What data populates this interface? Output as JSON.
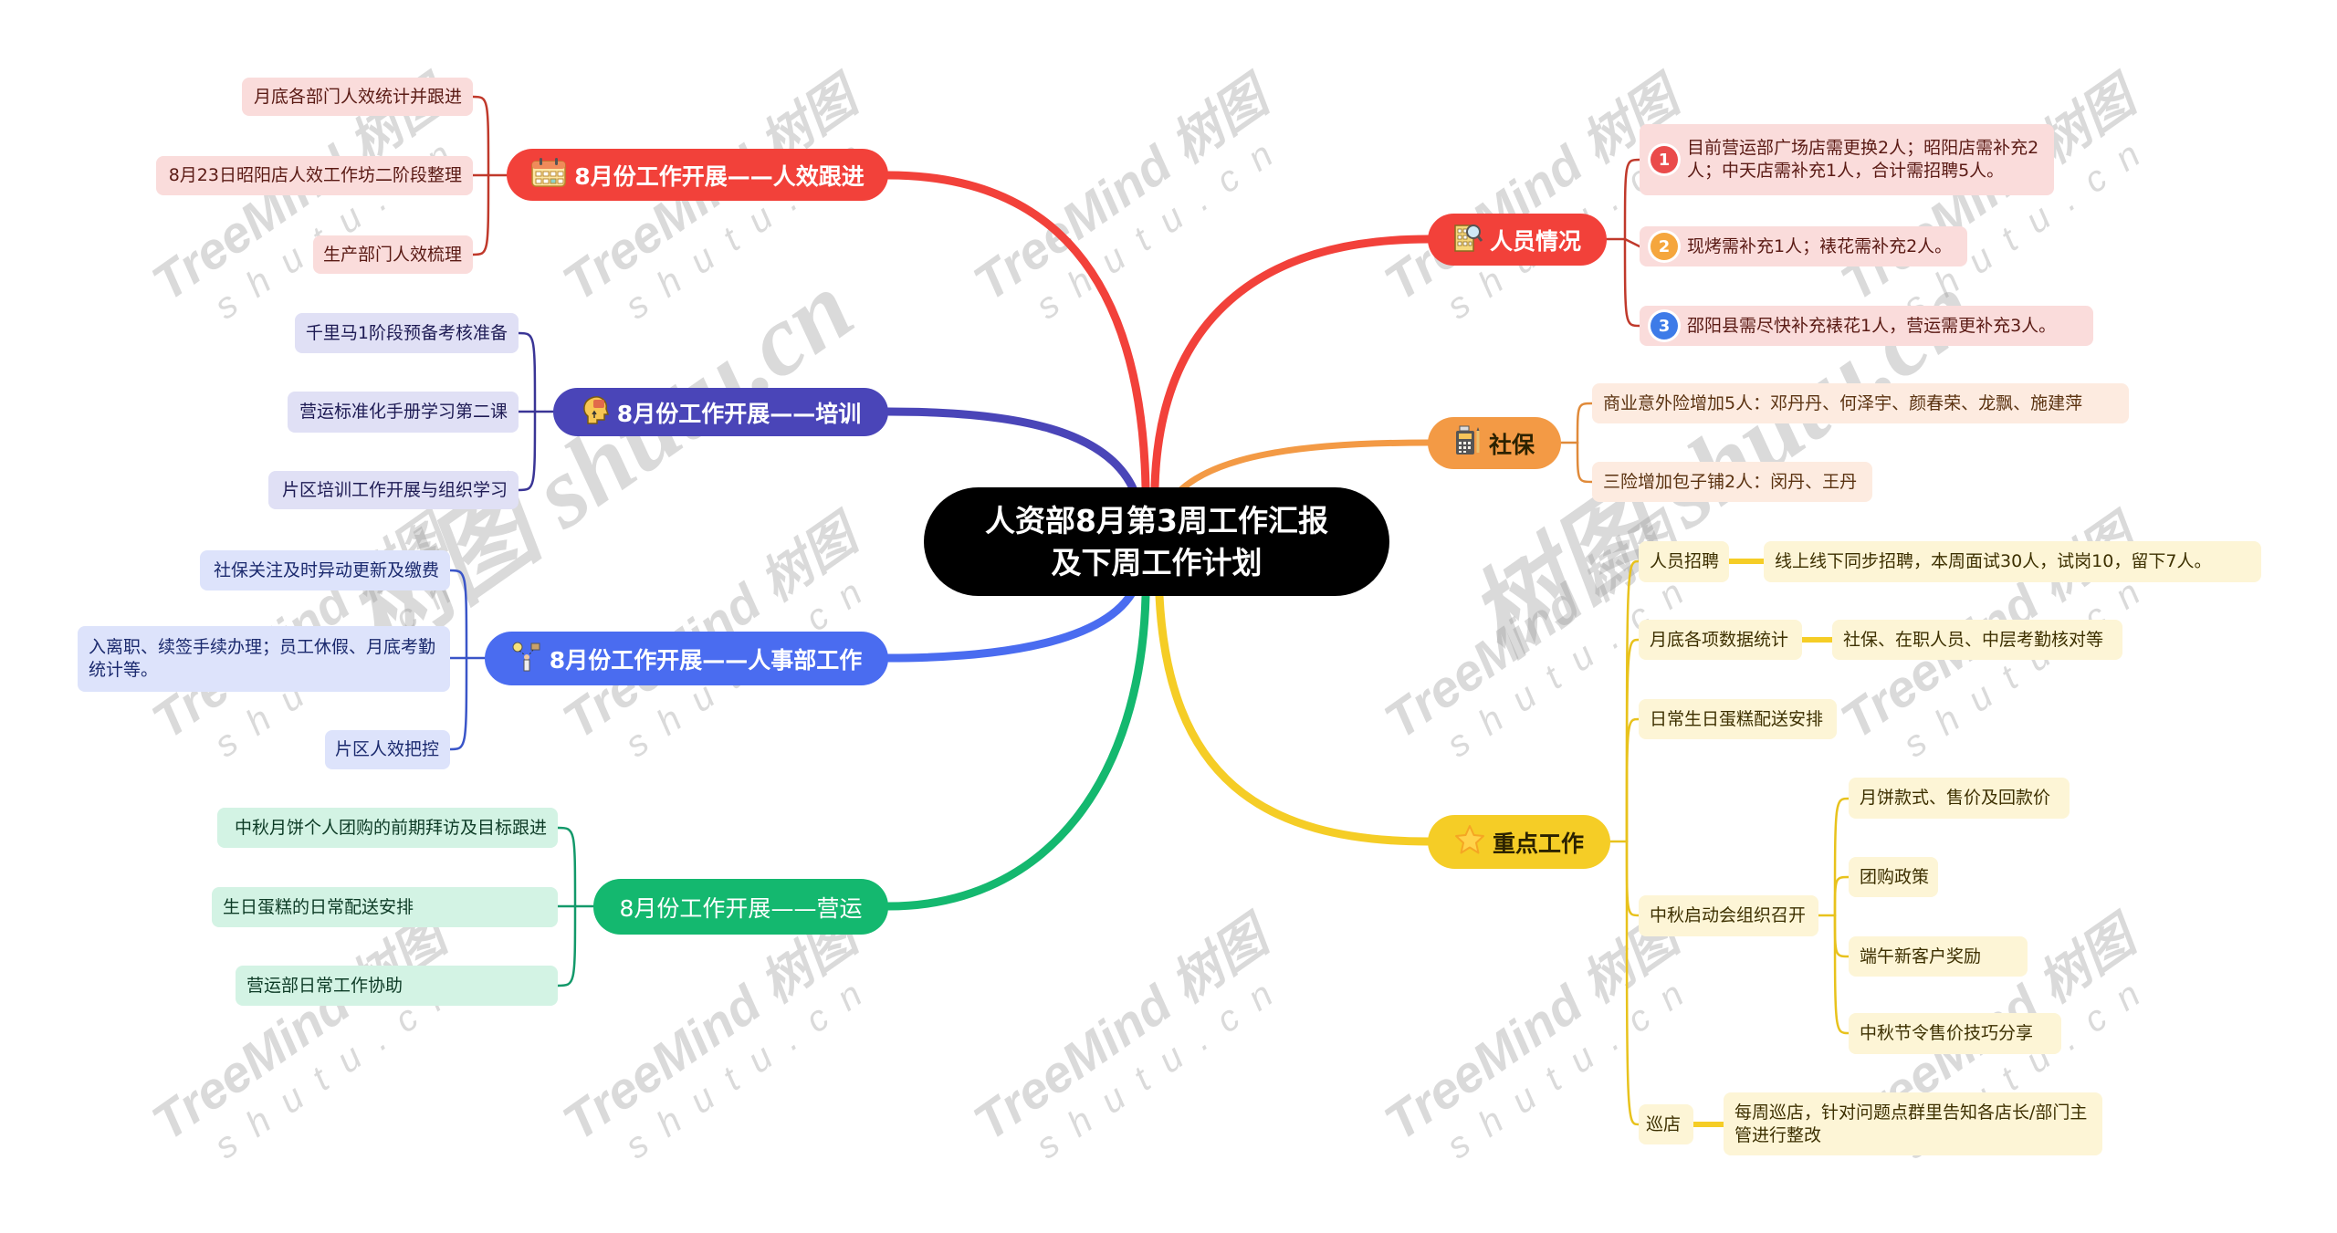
{
  "center": {
    "line1": "人资部8月第3周工作汇报",
    "line2": "及下周工作计划"
  },
  "colors": {
    "red": "#f2413a",
    "purple": "#4a45b8",
    "blue": "#4a6cf0",
    "green": "#14b86f",
    "orange": "#f39a45",
    "yellow": "#f5cd26",
    "red_leaf": "#fadcdb",
    "purple_leaf": "#e0e0f5",
    "blue_leaf": "#dde3fb",
    "green_leaf": "#d3f3e4",
    "orange_leaf": "#fdebe0",
    "yellow_leaf": "#fdf5d6"
  },
  "left": [
    {
      "label": "8月份工作开展——人效跟进",
      "icon": "calendar-icon",
      "children": [
        "月底各部门人效统计并跟进",
        "8月23日昭阳店人效工作坊二阶段整理",
        "生产部门人效梳理"
      ]
    },
    {
      "label": "8月份工作开展——培训",
      "icon": "head-idea-icon",
      "children": [
        "千里马1阶段预备考核准备",
        "营运标准化手册学习第二课",
        "片区培训工作开展与组织学习"
      ]
    },
    {
      "label": "8月份工作开展——人事部工作",
      "icon": "people-idea-icon",
      "children": [
        "社保关注及时异动更新及缴费",
        "入离职、续签手续办理；员工休假、月底考勤统计等。",
        "片区人效把控"
      ]
    },
    {
      "label": "8月份工作开展——营运",
      "icon": "",
      "children": [
        "中秋月饼个人团购的前期拜访及目标跟进",
        "生日蛋糕的日常配送安排",
        "营运部日常工作协助"
      ]
    }
  ],
  "right": {
    "staffing": {
      "label": "人员情况",
      "icon": "building-search-icon",
      "children": [
        {
          "num": "1",
          "text": "目前营运部广场店需更换2人；昭阳店需补充2人；中天店需补充1人，合计需招聘5人。"
        },
        {
          "num": "2",
          "text": "现烤需补充1人；裱花需补充2人。"
        },
        {
          "num": "3",
          "text": "邵阳县需尽快补充裱花1人，营运需更补充3人。"
        }
      ]
    },
    "social_insurance": {
      "label": "社保",
      "icon": "calculator-icon",
      "children": [
        "商业意外险增加5人：邓丹丹、何泽宇、颜春荣、龙飘、施建萍",
        "三险增加包子铺2人：闵丹、王丹"
      ]
    },
    "key_work": {
      "label": "重点工作",
      "icon": "star-icon",
      "children": [
        {
          "label": "人员招聘",
          "detail": "线上线下同步招聘，本周面试30人，试岗10，留下7人。"
        },
        {
          "label": "月底各项数据统计",
          "detail": "社保、在职人员、中层考勤核对等"
        },
        {
          "label": "日常生日蛋糕配送安排"
        },
        {
          "label": "中秋启动会组织召开",
          "subs": [
            "月饼款式、售价及回款价",
            "团购政策",
            "端午新客户奖励",
            "中秋节令售价技巧分享"
          ]
        },
        {
          "label": "巡店",
          "detail": "每周巡店，针对问题点群里告知各店长/部门主管进行整改"
        }
      ]
    }
  },
  "watermark": {
    "brand": "TreeMind 树图",
    "domain": "shutu.cn",
    "big": "树图 shutu.cn"
  }
}
